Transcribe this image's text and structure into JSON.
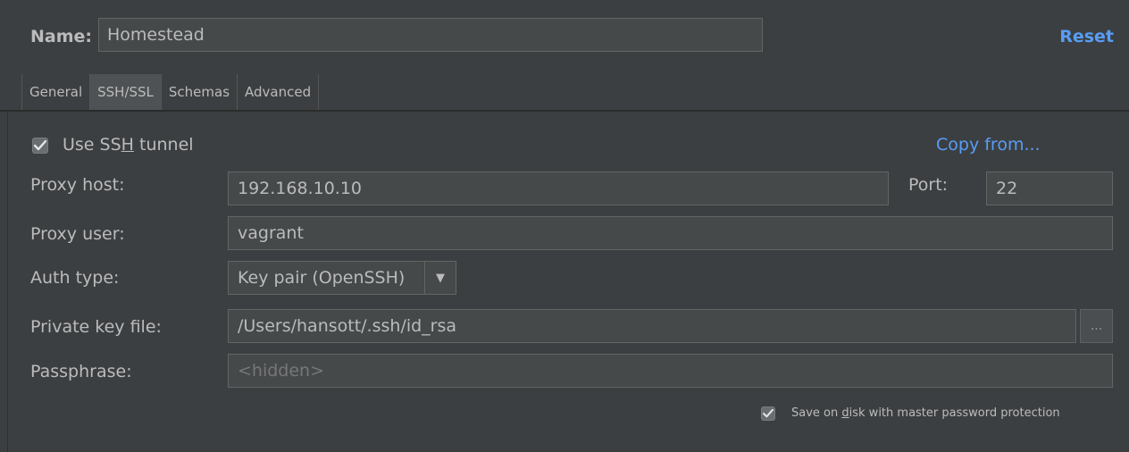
{
  "header": {
    "name_label": "Name:",
    "name_value": "Homestead",
    "reset_label": "Reset"
  },
  "tabs": [
    {
      "label": "General",
      "active": false
    },
    {
      "label": "SSH/SSL",
      "active": true
    },
    {
      "label": "Schemas",
      "active": false
    },
    {
      "label": "Advanced",
      "active": false
    }
  ],
  "ssh": {
    "use_tunnel_prefix": "Use SS",
    "use_tunnel_mnemonic": "H",
    "use_tunnel_suffix": " tunnel",
    "use_tunnel_checked": true,
    "copy_from_label": "Copy from...",
    "proxy_host_label": "Proxy host:",
    "proxy_host_value": "192.168.10.10",
    "port_label": "Port:",
    "port_value": "22",
    "proxy_user_label": "Proxy user:",
    "proxy_user_value": "vagrant",
    "auth_type_label": "Auth type:",
    "auth_type_value": "Key pair (OpenSSH)",
    "private_key_label": "Private key file:",
    "private_key_value": "/Users/hansott/.ssh/id_rsa",
    "browse_label": "...",
    "passphrase_label": "Passphrase:",
    "passphrase_placeholder": "<hidden>",
    "save_prefix": "Save on ",
    "save_mnemonic": "d",
    "save_suffix": "isk with master password protection",
    "save_checked": true
  },
  "colors": {
    "background": "#3c3f41",
    "field": "#45494a",
    "link": "#589df6",
    "text": "#bbbbbb"
  }
}
